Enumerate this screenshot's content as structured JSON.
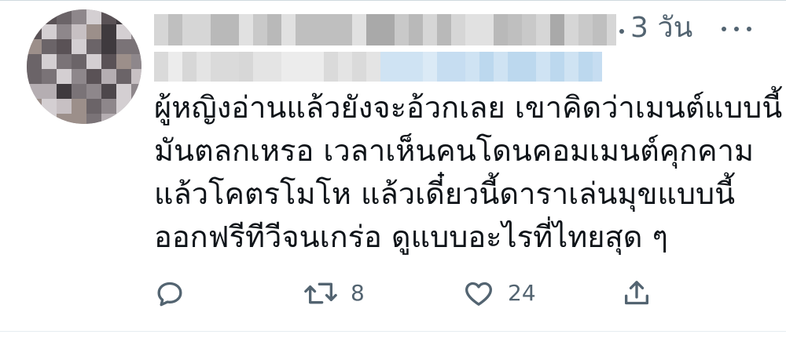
{
  "tweet": {
    "timestamp": "3 วัน",
    "body_lines": [
      "ผู้หญิงอ่านแล้วยังจะอ้วกเลย เขาคิดว่าเมนต์แบบนี้",
      "มันตลกเหรอ เวลาเห็นคนโดนคอมเมนต์คุกคาม",
      "แล้วโคตรโมโห แล้วเดี๋ยวนี้ดาราเล่นมุขแบบนี้",
      "ออกฟรีทีวีจนเกร่อ ดูแบบอะไรที่ไทยสุด ๆ"
    ],
    "actions": {
      "reply": {
        "icon": "reply-icon",
        "count": ""
      },
      "retweet": {
        "icon": "retweet-icon",
        "count": "8"
      },
      "like": {
        "icon": "heart-icon",
        "count": "24"
      },
      "share": {
        "icon": "share-icon",
        "count": ""
      }
    }
  },
  "colors": {
    "text": "#0f1419",
    "secondary": "#536471",
    "divider": "#cfd9de"
  }
}
